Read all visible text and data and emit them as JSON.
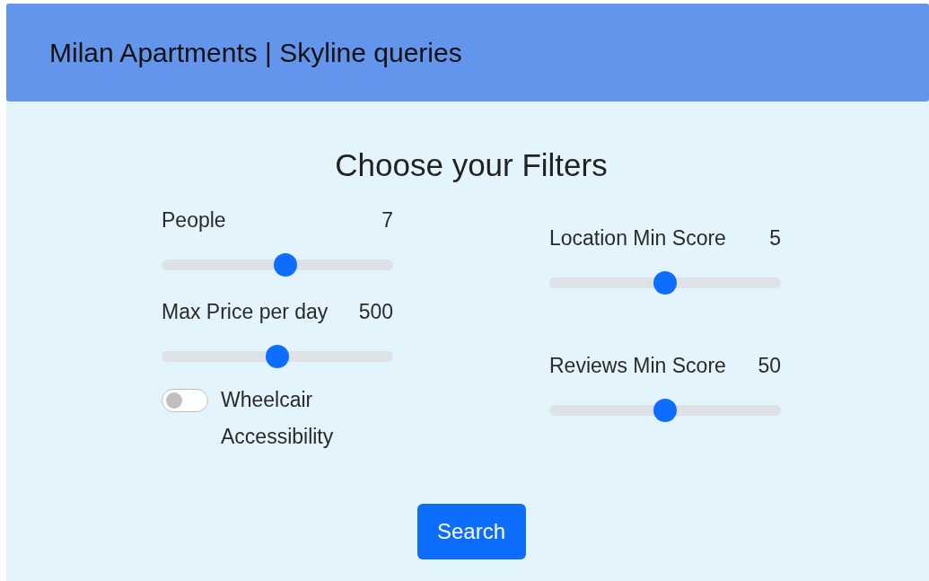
{
  "header": {
    "title": "Milan Apartments | Skyline queries"
  },
  "heading": "Choose your Filters",
  "columns": [
    {
      "sliders": [
        {
          "label": "People",
          "value": "7",
          "level": 0.54
        },
        {
          "label": "Max Price per day",
          "value": "500",
          "level": 0.5
        }
      ],
      "toggle": {
        "label": "Wheelcair Accessibility",
        "checked": false
      }
    },
    {
      "sliders": [
        {
          "label": "Location Min Score",
          "value": "5",
          "level": 0.5
        },
        {
          "label": "Reviews Min Score",
          "value": "50",
          "level": 0.5
        }
      ]
    }
  ],
  "button": "Search"
}
